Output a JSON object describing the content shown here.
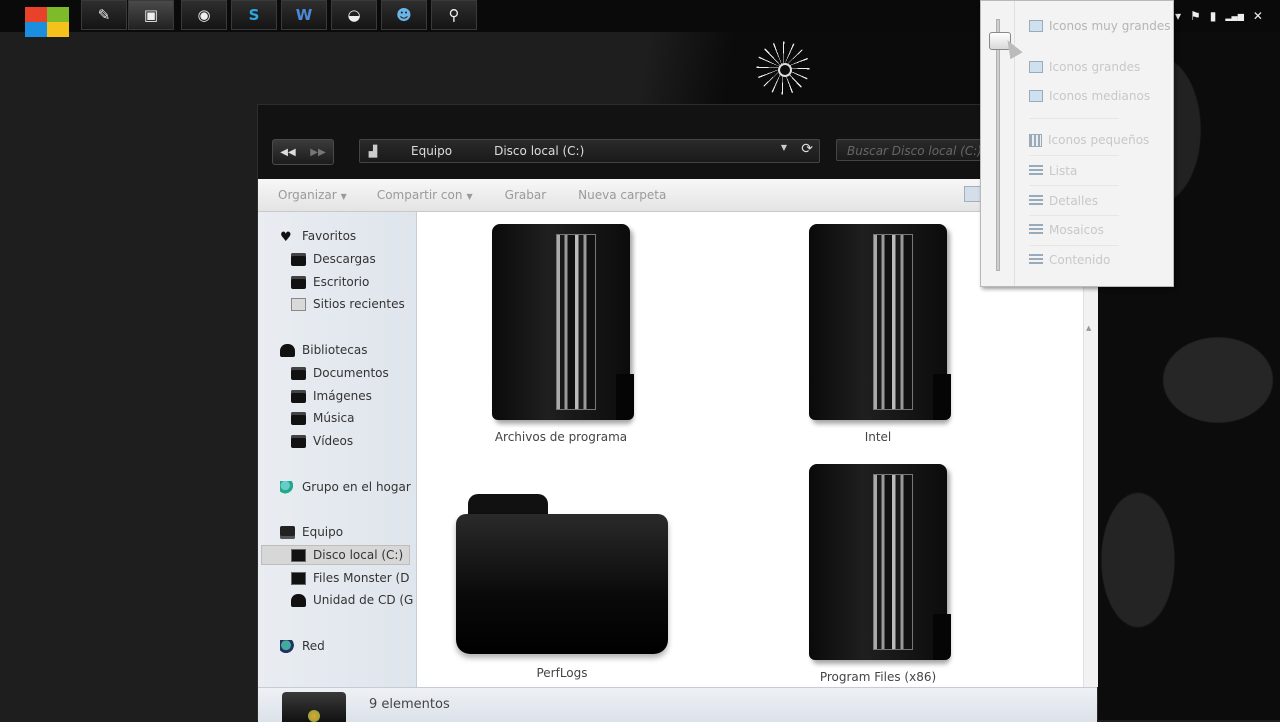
{
  "taskbar": {
    "buttons": [
      {
        "icon": "quill-icon",
        "glyph": "✎"
      },
      {
        "icon": "media-center-icon",
        "glyph": "▣"
      },
      {
        "icon": "firefox-icon",
        "glyph": "◉"
      },
      {
        "icon": "skype-icon",
        "glyph": "S"
      },
      {
        "icon": "word-icon",
        "glyph": "W"
      },
      {
        "icon": "network-icon",
        "glyph": "◒"
      },
      {
        "icon": "users-icon",
        "glyph": "☻"
      },
      {
        "icon": "tools-icon",
        "glyph": "⚲"
      }
    ],
    "tray_glyphs": [
      "▾",
      "⚑",
      "▮",
      "▂▄▆",
      "✕"
    ]
  },
  "window": {
    "back_glyph": "◀◀",
    "forward_glyph": "▶▶",
    "breadcrumb": [
      "Equipo",
      "Disco local (C:)"
    ],
    "search_placeholder": "Buscar Disco local (C:)",
    "commands": [
      {
        "label": "Organizar",
        "dropdown": true
      },
      {
        "label": "Compartir con",
        "dropdown": true
      },
      {
        "label": "Grabar",
        "dropdown": false
      },
      {
        "label": "Nueva carpeta",
        "dropdown": false
      }
    ],
    "sidebar": {
      "favorites": {
        "label": "Favoritos",
        "icon": "heart-icon"
      },
      "favorites_items": [
        {
          "label": "Descargas",
          "icon": "downloads-folder-icon"
        },
        {
          "label": "Escritorio",
          "icon": "desktop-folder-icon"
        },
        {
          "label": "Sitios recientes",
          "icon": "recent-places-icon"
        }
      ],
      "libraries": {
        "label": "Bibliotecas",
        "icon": "library-icon"
      },
      "libraries_items": [
        {
          "label": "Documentos",
          "icon": "documents-icon"
        },
        {
          "label": "Imágenes",
          "icon": "pictures-icon"
        },
        {
          "label": "Música",
          "icon": "music-icon"
        },
        {
          "label": "Vídeos",
          "icon": "videos-icon"
        }
      ],
      "homegroup": {
        "label": "Grupo en el hogar",
        "icon": "homegroup-icon"
      },
      "computer": {
        "label": "Equipo",
        "icon": "computer-icon"
      },
      "computer_items": [
        {
          "label": "Disco local (C:)",
          "icon": "local-disk-icon",
          "selected": true
        },
        {
          "label": "Files Monster (D",
          "icon": "drive-icon"
        },
        {
          "label": "Unidad de CD (G",
          "icon": "cd-drive-icon"
        }
      ],
      "network": {
        "label": "Red",
        "icon": "network-icon"
      }
    },
    "items": [
      {
        "label": "Archivos de programa",
        "kind": "drawer"
      },
      {
        "label": "Intel",
        "kind": "drawer"
      },
      {
        "label": "PerfLogs",
        "kind": "folder"
      },
      {
        "label": "Program Files (x86)",
        "kind": "drawer"
      }
    ],
    "status": {
      "count_text": "9 elementos"
    }
  },
  "view_menu": {
    "options": [
      {
        "label": "Iconos muy grandes",
        "icon": "extra-large-icons-icon"
      },
      {
        "label": "Iconos grandes",
        "icon": "large-icons-icon"
      },
      {
        "label": "Iconos medianos",
        "icon": "medium-icons-icon"
      },
      {
        "label": "Iconos pequeños",
        "icon": "small-icons-icon"
      },
      {
        "label": "Lista",
        "icon": "list-icon"
      },
      {
        "label": "Detalles",
        "icon": "details-icon"
      },
      {
        "label": "Mosaicos",
        "icon": "tiles-icon"
      },
      {
        "label": "Contenido",
        "icon": "content-icon"
      }
    ]
  }
}
